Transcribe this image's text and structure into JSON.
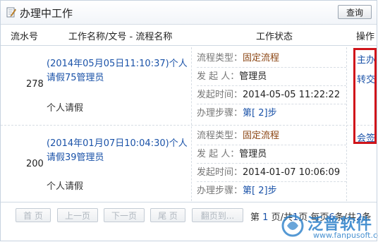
{
  "window": {
    "title": "办理中工作",
    "query_label": "查询"
  },
  "columns": {
    "serial": "流水号",
    "name": "工作名称/文号 - 流程名称",
    "status": "工作状态",
    "ops": "操作"
  },
  "rows": [
    {
      "serial": "278",
      "title": "(2014年05月05日11:10:37)个人请假75管理员",
      "flow": "个人请假",
      "flow_type_label": "流程类型：",
      "flow_type": "固定流程",
      "initiator_label": "发 起 人：",
      "initiator": "管理员",
      "time_label": "发起时间：",
      "time": "2014-05-05 11:22:22",
      "step_label": "办理步骤：",
      "step": "第[ 2]步",
      "ops": [
        "主办",
        "转交"
      ]
    },
    {
      "serial": "200",
      "title": "(2014年01月07日10:04:30)个人请假39管理员",
      "flow": "个人请假",
      "flow_type_label": "流程类型：",
      "flow_type": "固定流程",
      "initiator_label": "发 起 人：",
      "initiator": "管理员",
      "time_label": "发起时间：",
      "time": "2014-01-07 10:06:09",
      "step_label": "办理步骤：",
      "step": "第[ 2]步",
      "ops": [
        "会签"
      ]
    }
  ],
  "pager": {
    "first": "首 页",
    "prev": "上一页",
    "next": "下一页",
    "last": "尾 页",
    "goto": "翻页到...",
    "text_a": "第",
    "current": "1",
    "text_b": "页/共",
    "total_pages": "1",
    "text_c": "页 每页",
    "per_page": "6",
    "text_d": "条/共",
    "total": "2",
    "text_e": "条"
  },
  "watermark": {
    "brand": "泛普软件",
    "url": "www.fanpusoft.com"
  },
  "colors": {
    "link": "#1a52a8",
    "highlight": "#d0141a",
    "border": "#c7d3e0"
  }
}
